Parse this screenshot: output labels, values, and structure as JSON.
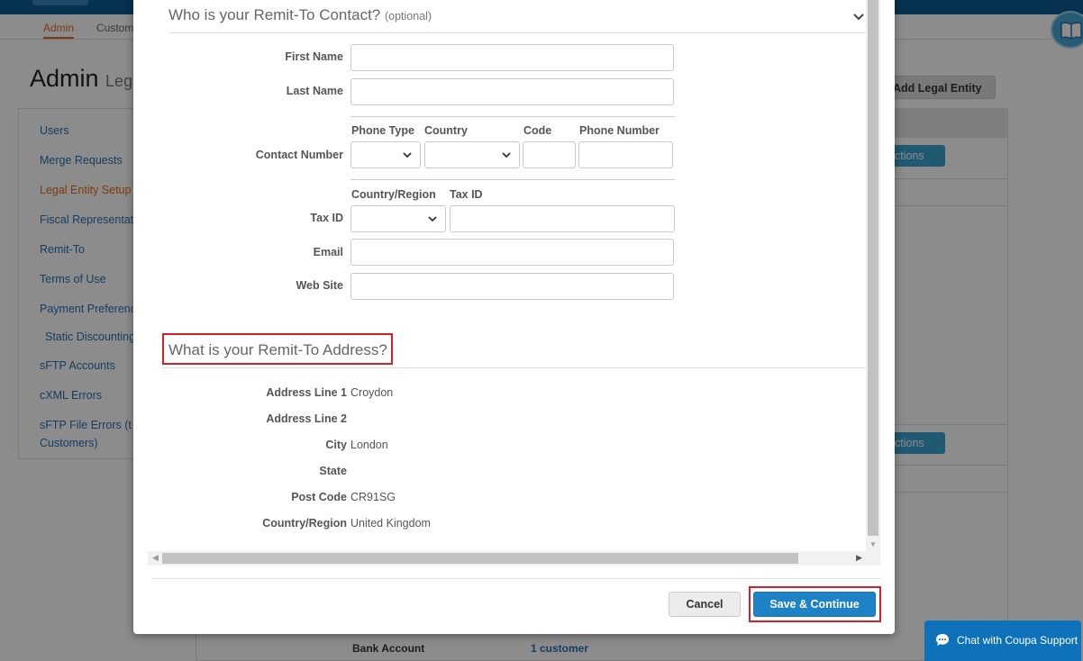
{
  "background": {
    "nav": {
      "admin": "Admin",
      "customers": "Custom"
    },
    "page_title": "Admin",
    "page_subtitle": "Leg",
    "sidebar": [
      {
        "label": "Users"
      },
      {
        "label": "Merge Requests"
      },
      {
        "label": "Legal Entity Setup",
        "active": true
      },
      {
        "label": "Fiscal Representat"
      },
      {
        "label": "Remit-To"
      },
      {
        "label": "Terms of Use"
      },
      {
        "label": "Payment Preferenc"
      },
      {
        "label": "Static Discounting"
      },
      {
        "label": "sFTP Accounts"
      },
      {
        "label": "cXML Errors"
      },
      {
        "label": "sFTP File Errors (t"
      },
      {
        "label": "Customers)"
      }
    ],
    "add_legal_entity": "Add Legal Entity",
    "actions_label": "ctions",
    "bank_account_label": "Bank Account",
    "bank_account_link": "1 customer"
  },
  "modal": {
    "contact_section": {
      "title": "Who is your Remit-To Contact?",
      "optional": "(optional)",
      "first_name_label": "First Name",
      "first_name_value": "",
      "last_name_label": "Last Name",
      "last_name_value": "",
      "contact_number_label": "Contact Number",
      "phone_type_label": "Phone Type",
      "country_label": "Country",
      "code_label": "Code",
      "phone_number_label": "Phone Number",
      "phone_type_value": "",
      "country_value": "",
      "code_value": "",
      "phone_number_value": "",
      "tax_id_label": "Tax ID",
      "country_region_col_label": "Country/Region",
      "tax_id_col_label": "Tax ID",
      "tax_country_value": "",
      "tax_id_value": "",
      "email_label": "Email",
      "email_value": "",
      "website_label": "Web Site",
      "website_value": ""
    },
    "address_section": {
      "title": "What is your Remit-To Address?",
      "fields": [
        {
          "label": "Address Line 1",
          "value": "Croydon"
        },
        {
          "label": "Address Line 2",
          "value": ""
        },
        {
          "label": "City",
          "value": "London"
        },
        {
          "label": "State",
          "value": ""
        },
        {
          "label": "Post Code",
          "value": "CR91SG"
        },
        {
          "label": "Country/Region",
          "value": "United Kingdom"
        }
      ]
    },
    "buttons": {
      "cancel": "Cancel",
      "save_continue": "Save & Continue"
    }
  },
  "chat": {
    "label": "Chat with Coupa Support"
  },
  "colors": {
    "brand_blue": "#0b5a92",
    "primary_button": "#1d82c6",
    "highlight_red": "#d4202a",
    "active_orange": "#e36a1d"
  }
}
